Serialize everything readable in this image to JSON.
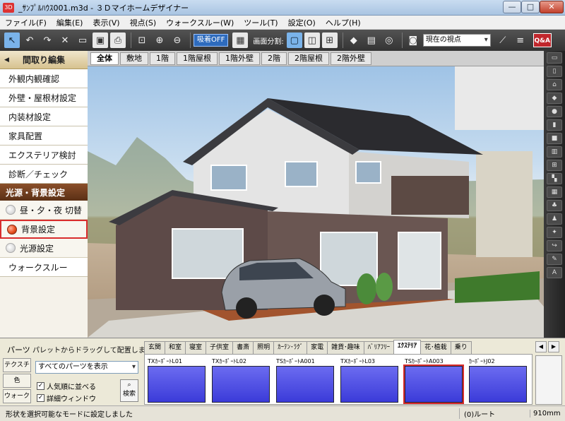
{
  "window": {
    "title": "_ｻﾝﾌﾟﾙﾊｳｽ001.m3d - ３Ｄマイホームデザイナー",
    "app_icon": "3D",
    "minimize": "—",
    "maximize": "□",
    "close": "✕"
  },
  "menu": [
    "ファイル(F)",
    "編集(E)",
    "表示(V)",
    "視点(S)",
    "ウォークスルー(W)",
    "ツール(T)",
    "設定(O)",
    "ヘルプ(H)"
  ],
  "toolbar": {
    "adsorb_label": "吸着OFF",
    "split_label": "画面分割:",
    "viewpoint_value": "現在の視点",
    "qa_label": "Q&A",
    "icons": [
      "pointer-icon",
      "undo-icon",
      "redo-icon",
      "delete-icon",
      "open-folder-icon",
      "save-icon",
      "print-icon",
      "zoom-fit-icon",
      "zoom-in-icon",
      "zoom-out-icon",
      "grid-icon",
      "split-single-icon",
      "split-two-icon",
      "split-four-icon",
      "paint-icon",
      "box-icon",
      "target-icon",
      "camera-icon",
      "ruler-icon",
      "layers-icon"
    ]
  },
  "left_panel": {
    "header": "間取り編集",
    "items": [
      "外観内観確認",
      "外壁・屋根材設定",
      "内装材設定",
      "家具配置",
      "エクステリア検討",
      "診断／チェック"
    ],
    "section": "光源・背景設定",
    "radios": [
      {
        "label": "昼・夕・夜 切替",
        "selected": false
      },
      {
        "label": "背景設定",
        "selected": true
      },
      {
        "label": "光源設定",
        "selected": false
      }
    ],
    "walkthrough": "ウォークスルー"
  },
  "floor_tabs": [
    "全体",
    "敷地",
    "1階",
    "1階屋根",
    "1階外壁",
    "2階",
    "2階屋根",
    "2階外壁"
  ],
  "active_floor_tab": "全体",
  "palette": {
    "parts_label": "パーツ",
    "hint": "パレットからドラッグして配置します。",
    "side_tabs": [
      "テクスチャ",
      "色",
      "ウォーク"
    ],
    "filter_value": "すべてのパーツを表示",
    "checkbox_sort": "人気順に並べる",
    "checkbox_detail": "詳細ウィンドウ",
    "search_label": "検索",
    "categories": [
      "玄関",
      "和室",
      "寝室",
      "子供室",
      "書斎",
      "照明",
      "ｶｰﾃﾝ･ﾗｸﾞ",
      "家電",
      "雑貨･趣味",
      "ﾊﾞﾘｱﾌﾘｰ",
      "ｴｸｽﾃﾘｱ",
      "花･植栽",
      "乗り"
    ],
    "active_category": "ｴｸｽﾃﾘｱ",
    "thumbnails": [
      {
        "label": "TXｶｰﾎﾟｰﾄL01",
        "selected": false
      },
      {
        "label": "TXｶｰﾎﾟｰﾄL02",
        "selected": false
      },
      {
        "label": "TSｶｰﾎﾟｰﾄA001",
        "selected": false
      },
      {
        "label": "TXｶｰﾎﾟｰﾄL03",
        "selected": false
      },
      {
        "label": "TSｶｰﾎﾟｰﾄA003",
        "selected": true
      },
      {
        "label": "ｶｰﾎﾟｰﾄJ02",
        "selected": false
      }
    ]
  },
  "status": {
    "message": "形状を選択可能なモードに設定しました",
    "root": "(0)ルート",
    "size": "910mm"
  }
}
